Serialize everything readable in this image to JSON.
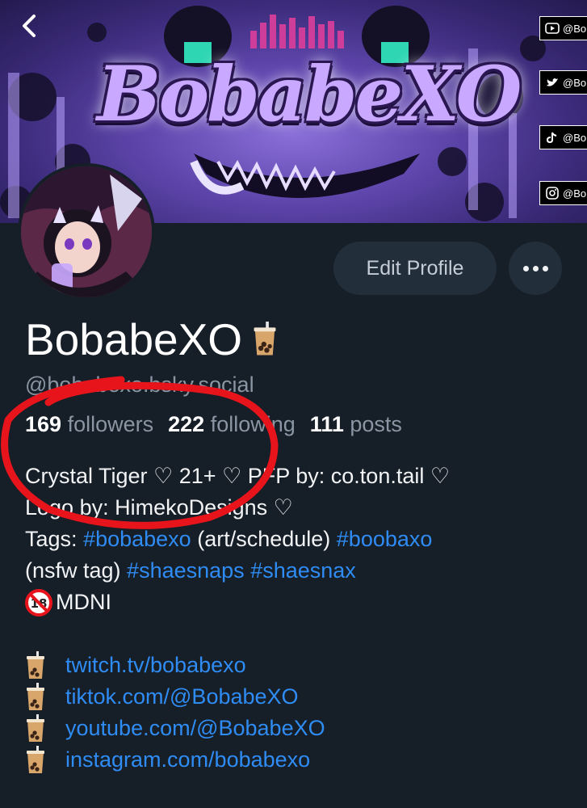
{
  "banner": {
    "logo_text": "BobabeXO",
    "social_tags": [
      {
        "icon": "youtube-icon",
        "text": "@Bob"
      },
      {
        "icon": "twitter-icon",
        "text": "@Bo"
      },
      {
        "icon": "tiktok-icon",
        "text": "@Bo"
      },
      {
        "icon": "instagram-icon",
        "text": "@Bo"
      }
    ]
  },
  "profile": {
    "display_name": "BobabeXO",
    "handle": "@bobabexo.bsky.social",
    "followers_count": "169",
    "followers_label": "followers",
    "following_count": "222",
    "following_label": "following",
    "posts_count": "111",
    "posts_label": "posts"
  },
  "actions": {
    "edit_profile_label": "Edit Profile"
  },
  "bio": {
    "line1": "Crystal Tiger ♡ 21+ ♡ PFP by: co.ton.tail ♡",
    "line2": "Logo by: HimekoDesigns ♡",
    "line3_prefix": "Tags: ",
    "tag1": "#bobabexo",
    "line3_mid": " (art/schedule) ",
    "tag2": "#boobaxo",
    "line4_prefix": "(nsfw tag) ",
    "tag3": "#shaesnaps",
    "tag4": "#shaesnax",
    "mdni": "MDNI",
    "links": [
      "twitch.tv/bobabexo",
      "tiktok.com/@BobabeXO",
      "youtube.com/@BobabeXO",
      "instagram.com/bobabexo"
    ]
  },
  "colors": {
    "background": "#161e27",
    "button_bg": "#232e3b",
    "link": "#2f8cf4",
    "muted": "#8a96a3",
    "annotation_red": "#e8141c"
  }
}
